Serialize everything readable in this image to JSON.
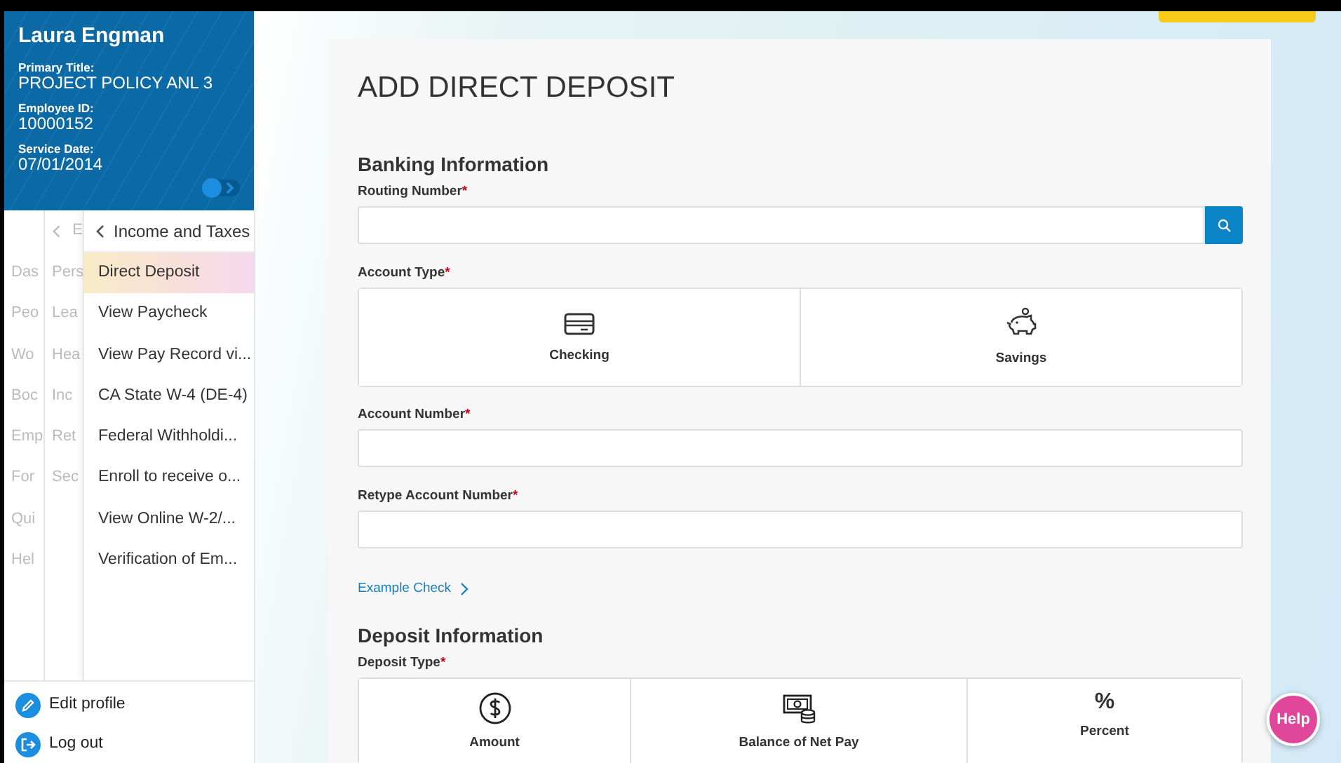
{
  "profile": {
    "name": "Laura Engman",
    "fields": [
      {
        "label": "Primary Title:",
        "value": "PROJECT POLICY ANL 3"
      },
      {
        "label": "Employee ID:",
        "value": "10000152"
      },
      {
        "label": "Service Date:",
        "value": "07/01/2014"
      }
    ]
  },
  "nav_level1": {
    "items": [
      "Das",
      "Peo",
      "Wo",
      "Boc",
      "Emp",
      "For",
      "Qui",
      "Hel"
    ]
  },
  "nav_level2": {
    "title": "E",
    "items": [
      "Pers",
      "Lea",
      "Hea",
      "Inc",
      "Ret",
      "Sec"
    ]
  },
  "menu": {
    "title": "Income and Taxes",
    "items": [
      {
        "label": "Direct Deposit",
        "selected": true
      },
      {
        "label": "View Paycheck",
        "selected": false
      },
      {
        "label": "View Pay Record vi...",
        "selected": false
      },
      {
        "label": "CA State W-4 (DE-4)",
        "selected": false
      },
      {
        "label": "Federal Withholdi...",
        "selected": false
      },
      {
        "label": "Enroll to receive o...",
        "selected": false
      },
      {
        "label": "View Online W-2/...",
        "selected": false
      },
      {
        "label": "Verification of Em...",
        "selected": false
      }
    ]
  },
  "footer_links": [
    {
      "label": "Edit profile",
      "kind": "edit"
    },
    {
      "label": "Log out",
      "kind": "logout"
    }
  ],
  "page_title": "ADD DIRECT DEPOSIT",
  "banking": {
    "heading": "Banking Information",
    "routing": {
      "label": "Routing Number",
      "required_mark": "*"
    },
    "account_type": {
      "label": "Account Type",
      "required_mark": "*",
      "options": [
        {
          "label": "Checking",
          "kind": "card",
          "selected": false
        },
        {
          "label": "Savings",
          "kind": "piggy",
          "selected": false
        }
      ]
    },
    "account_number": {
      "label": "Account Number",
      "required_mark": "*"
    },
    "retype": {
      "label": "Retype Account Number",
      "required_mark": "*"
    },
    "link": "Example Check"
  },
  "deposit": {
    "heading": "Deposit Information",
    "deposit_type": {
      "label": "Deposit Type",
      "required_mark": "*",
      "options": [
        {
          "label": "Amount",
          "kind": "dollar",
          "selected": false
        },
        {
          "label": "Balance of Net Pay",
          "kind": "cash",
          "selected": false
        },
        {
          "label": "Percent",
          "kind": "symbol",
          "symbol": "%",
          "selected": false
        }
      ]
    }
  },
  "help": "Help"
}
